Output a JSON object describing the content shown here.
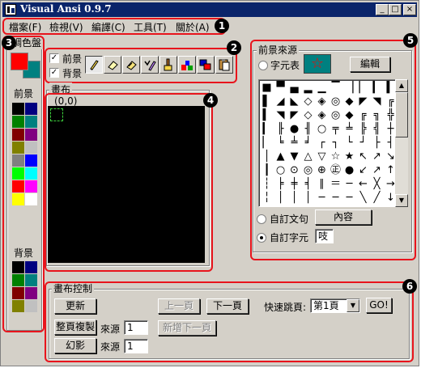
{
  "app": {
    "title": "Visual Ansi 0.9.7"
  },
  "window_controls": {
    "minimize": "_",
    "maximize": "□",
    "close": "×"
  },
  "menu": [
    "檔案(F)",
    "檢視(V)",
    "編譯(C)",
    "工具(T)",
    "關於(A)"
  ],
  "badges": [
    "1",
    "2",
    "3",
    "4",
    "5",
    "6"
  ],
  "palette": {
    "title": "調色盤",
    "fg_label": "前景",
    "bg_label": "背景",
    "current_fg": "#ff0000",
    "current_bg": "#008080",
    "fg_colors": [
      "#000000",
      "#000080",
      "#008000",
      "#008080",
      "#800000",
      "#800080",
      "#808000",
      "#c0c0c0",
      "#808080",
      "#0000ff",
      "#00ff00",
      "#00ffff",
      "#ff0000",
      "#ff00ff",
      "#ffff00",
      "#ffffff"
    ],
    "bg_colors": [
      "#000000",
      "#000080",
      "#008000",
      "#008080",
      "#800000",
      "#800080",
      "#808000",
      "#c0c0c0"
    ]
  },
  "toolbar": {
    "fg_check_label": "前景",
    "bg_check_label": "背景",
    "fg_checked": true,
    "bg_checked": true,
    "tools": [
      "pencil-icon",
      "eraser-icon",
      "fill-eraser-icon",
      "color-pick-icon",
      "brush-icon",
      "character-icon",
      "swap-color-icon",
      "paste-icon"
    ]
  },
  "canvas": {
    "title": "畫布",
    "coords": "(0,0)"
  },
  "source": {
    "title": "前景來源",
    "charset_label": "字元表",
    "preview_char": "☆",
    "edit_button": "編輯",
    "custom_phrase_label": "自訂文句",
    "content_button": "內容",
    "custom_char_label": "自訂字元",
    "custom_char_value": "吱",
    "selected_option": "自訂字元",
    "chars": [
      "■",
      "▀",
      "▄",
      "▂",
      "▁",
      "▔",
      "▕",
      "▏",
      "▎",
      "▍",
      "▌",
      "◢",
      "◣",
      "◇",
      "◈",
      "◎",
      "◆",
      "◤",
      "◥",
      "╔",
      "▍",
      "◥",
      "◤",
      "◇",
      "◈",
      "◎",
      "◆",
      "╔",
      "╗",
      "╬",
      "▎",
      "╟",
      "●",
      "╢",
      "○",
      "╤",
      "╧",
      "╠",
      "╣",
      "┼",
      "▏",
      "╘",
      "╧",
      "╛",
      "┌",
      "┐",
      "└",
      "┘",
      "├",
      "┤",
      "│",
      "▲",
      "▼",
      "△",
      "▽",
      "☆",
      "★",
      "↖",
      "↗",
      "↘",
      "┃",
      "○",
      "⊙",
      "◎",
      "⊕",
      "㊣",
      "●",
      "↙",
      "↗",
      "↑",
      "┆",
      "╞",
      "╪",
      "╡",
      "∥",
      "＝",
      "─",
      "←",
      "╳",
      "→",
      "╎",
      "│",
      "│",
      "│",
      "─",
      "─",
      "─",
      "╲",
      "╱",
      "↓"
    ]
  },
  "controls": {
    "title": "畫布控制",
    "refresh_button": "更新",
    "prev_page_button": "上一頁",
    "next_page_button": "下一頁",
    "quick_jump_label": "快速跳頁:",
    "page_select_value": "第1頁",
    "go_button": "GO!",
    "copy_page_button": "整頁複製",
    "source_label": "來源",
    "copy_source_value": "1",
    "add_next_page_button": "新增下一頁",
    "ghost_button": "幻影",
    "ghost_source_label": "來源",
    "ghost_source_value": "1"
  }
}
